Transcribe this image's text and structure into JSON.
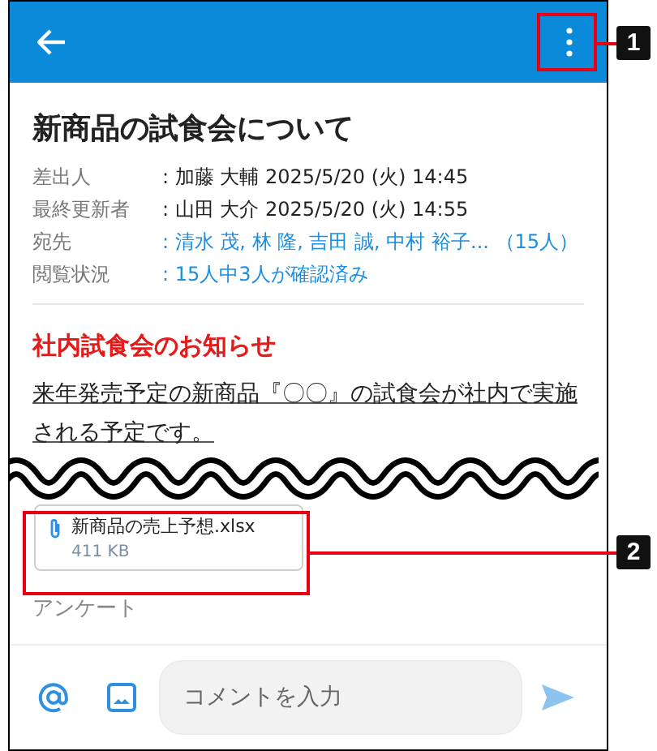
{
  "title": "新商品の試食会について",
  "meta": [
    {
      "label": "差出人",
      "value": ": 加藤 大輔  2025/5/20 (火) 14:45",
      "kind": "text"
    },
    {
      "label": "最終更新者",
      "value": ": 山田 大介  2025/5/20 (火) 14:55",
      "kind": "text"
    },
    {
      "label": "宛先",
      "value": ": 清水 茂, 林 隆, 吉田 誠, 中村 裕子... （15人）",
      "kind": "link"
    },
    {
      "label": "閲覧状況",
      "value": ": 15人中3人が確認済み",
      "kind": "link"
    }
  ],
  "section_heading": "社内試食会のお知らせ",
  "body": "来年発売予定の新商品『〇〇』の試食会が社内で実施される予定です。",
  "attachment": {
    "name": "新商品の売上予想.xlsx",
    "size": "411 KB"
  },
  "next_section": "アンケート",
  "comment": {
    "placeholder": "コメントを入力"
  },
  "callouts": [
    {
      "number": "1"
    },
    {
      "number": "2"
    }
  ]
}
